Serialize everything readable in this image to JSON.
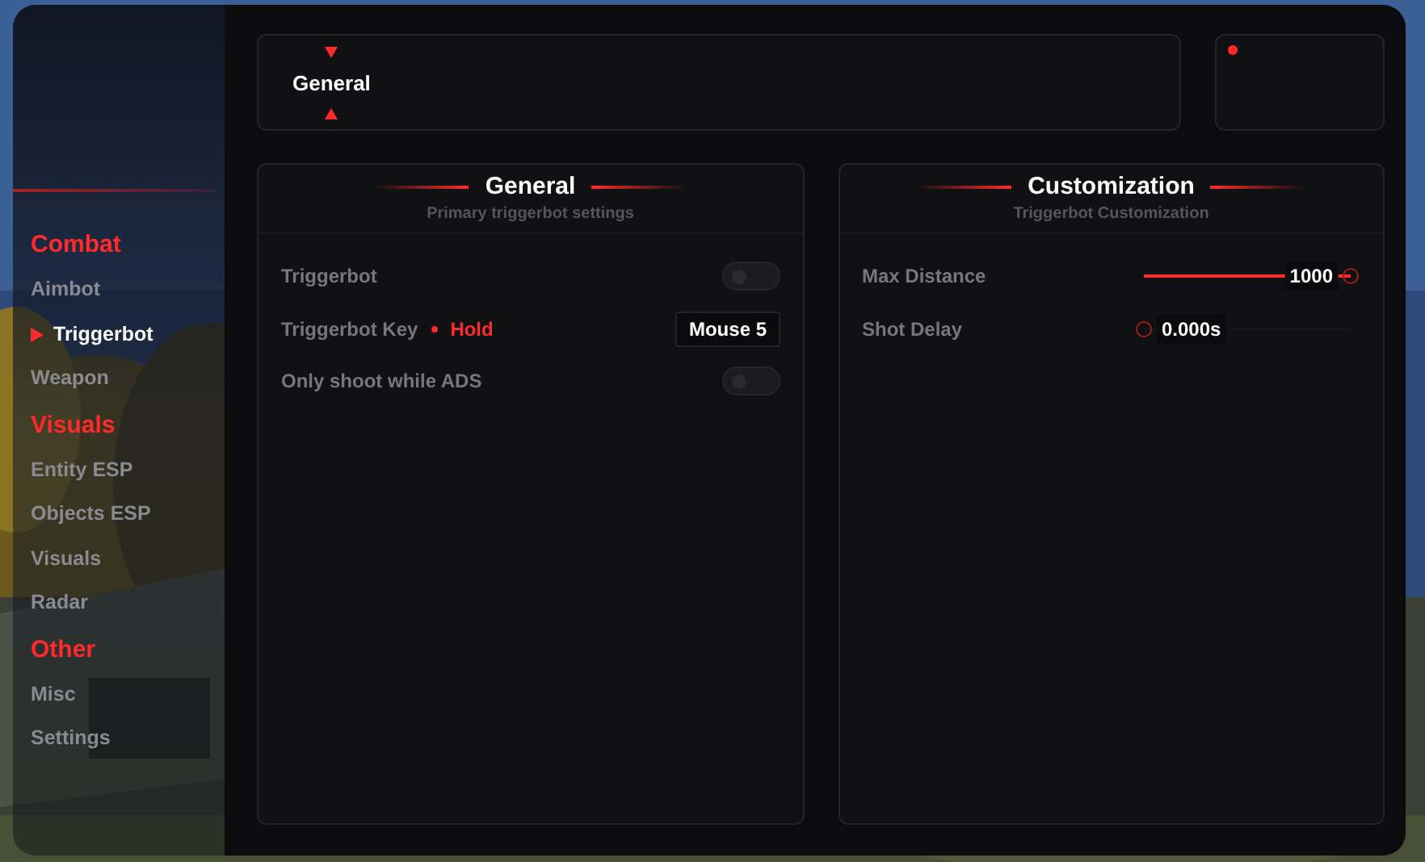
{
  "sidebar": {
    "sections": [
      {
        "title": "Combat",
        "items": [
          {
            "label": "Aimbot",
            "selected": false
          },
          {
            "label": "Triggerbot",
            "selected": true
          },
          {
            "label": "Weapon",
            "selected": false
          }
        ]
      },
      {
        "title": "Visuals",
        "items": [
          {
            "label": "Entity ESP",
            "selected": false
          },
          {
            "label": "Objects ESP",
            "selected": false
          },
          {
            "label": "Visuals",
            "selected": false
          },
          {
            "label": "Radar",
            "selected": false
          }
        ]
      },
      {
        "title": "Other",
        "items": [
          {
            "label": "Misc",
            "selected": false
          },
          {
            "label": "Settings",
            "selected": false
          }
        ]
      }
    ]
  },
  "top_bar": {
    "tab": {
      "label": "General"
    }
  },
  "panels": [
    {
      "title": "General",
      "subtitle": "Primary triggerbot settings",
      "rows": [
        {
          "kind": "toggle",
          "label": "Triggerbot",
          "on": false
        },
        {
          "kind": "keybind",
          "label": "Triggerbot Key",
          "mode": "Hold",
          "key": "Mouse 5"
        },
        {
          "kind": "toggle",
          "label": "Only shoot while ADS",
          "on": false
        }
      ]
    },
    {
      "title": "Customization",
      "subtitle": "Triggerbot Customization",
      "rows": [
        {
          "kind": "slider",
          "label": "Max Distance",
          "level": 1,
          "reading": "1000"
        },
        {
          "kind": "slider",
          "label": "Shot Delay",
          "level": 0,
          "reading": "0.000s"
        }
      ]
    }
  ]
}
